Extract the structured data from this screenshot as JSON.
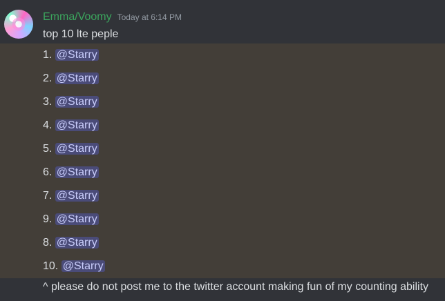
{
  "message": {
    "username": "Emma/Voomy",
    "timestamp": "Today at 6:14 PM",
    "first_line": "top 10 lte peple",
    "list": [
      {
        "number": "1.",
        "mention": "@Starry"
      },
      {
        "number": "2.",
        "mention": "@Starry"
      },
      {
        "number": "3.",
        "mention": "@Starry"
      },
      {
        "number": "4.",
        "mention": "@Starry"
      },
      {
        "number": "5.",
        "mention": "@Starry"
      },
      {
        "number": "6.",
        "mention": "@Starry"
      },
      {
        "number": "7.",
        "mention": "@Starry"
      },
      {
        "number": "9.",
        "mention": "@Starry"
      },
      {
        "number": "8.",
        "mention": "@Starry"
      },
      {
        "number": "10.",
        "mention": "@Starry"
      }
    ],
    "last_line": "^ please do not post me to the twitter account making fun of my counting ability"
  },
  "colors": {
    "background": "#313338",
    "username": "#3ba55d",
    "highlight": "#433e38",
    "mention_bg": "#4b4f8a",
    "mention_text": "#c9cdfb"
  }
}
